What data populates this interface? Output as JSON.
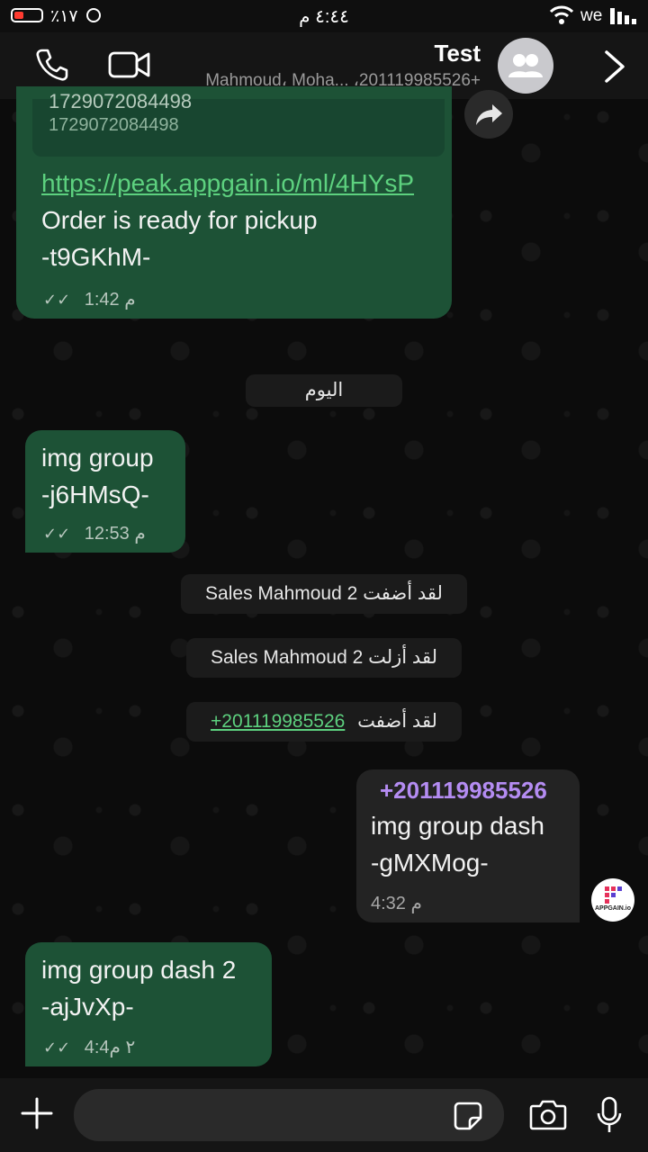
{
  "status_bar": {
    "battery_percent": "٪١٧",
    "time": "٤:٤٤ م",
    "carrier": "we"
  },
  "header": {
    "title": "Test",
    "subtitle": "Mahmoud، Moha... ،201119985526+"
  },
  "messages": [
    {
      "quoted_cut": "1729072084498",
      "quoted_number": "1729072084498",
      "link": "https://peak.appgain.io/ml/4HYsP",
      "line1": "Order is ready for pickup",
      "line2": "-t9GKhM-",
      "time": "1:42 م"
    },
    {
      "line1": "img group",
      "line2": "-j6HMsQ-",
      "time": "12:53 م"
    },
    {
      "sender": "+201119985526",
      "line1": "img group dash",
      "line2": "-gMXMog-",
      "time": "4:32 م"
    },
    {
      "line1": "img group dash 2",
      "line2": "-ajJvXp-",
      "time": "4:4٢ م"
    }
  ],
  "date_divider": "اليوم",
  "system_messages": [
    {
      "text": "لقد أضفت Sales Mahmoud 2"
    },
    {
      "text": "لقد أزلت Sales Mahmoud 2"
    },
    {
      "prefix": "لقد أضفت",
      "link": "+201119985526"
    }
  ],
  "avatar_badge": "APPGAIN.io",
  "composer": {
    "placeholder": ""
  },
  "colors": {
    "incoming_bubble": "#1d5236",
    "outgoing_bubble": "#232323",
    "link": "#5dd17f",
    "sender": "#b48cf2"
  }
}
